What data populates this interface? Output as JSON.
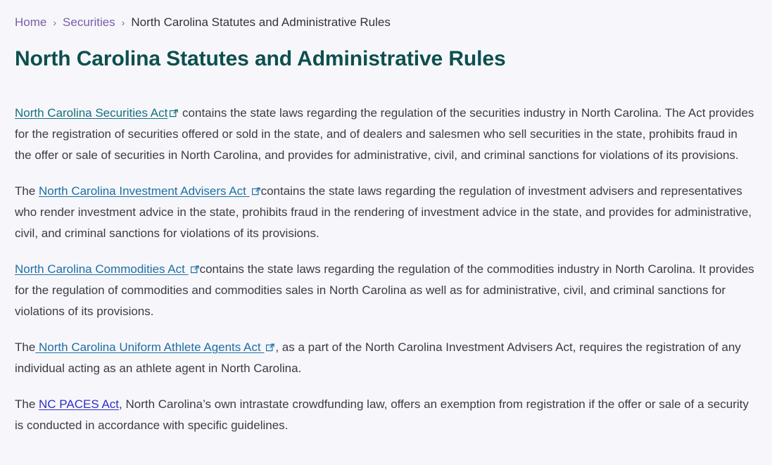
{
  "page": {
    "background_color": "#f7f7fb",
    "title": "North Carolina Statutes and Administrative Rules",
    "title_color": "#0d4f4f"
  },
  "breadcrumb": {
    "separator": "›",
    "link_color": "#7b5ea7",
    "items": [
      {
        "label": "Home",
        "type": "link"
      },
      {
        "label": "Securities",
        "type": "link"
      },
      {
        "label": "North Carolina Statutes and Administrative Rules",
        "type": "current"
      }
    ]
  },
  "icons": {
    "external_link": "external-link-icon",
    "chevron_right": "chevron-right-icon"
  },
  "content": {
    "paragraphs": [
      {
        "id": "securities-act",
        "lead_text": "",
        "link_text": "North Carolina Securities Act",
        "link_color": "#15707f",
        "has_external_icon": true,
        "body_text": " contains the state laws regarding the regulation of the securities industry in North Carolina. The Act provides for the registration of securities offered or sold in the state, and of dealers and salesmen who sell securities in the state, prohibits fraud in the offer or sale of securities in North Carolina, and provides for administrative, civil, and criminal sanctions for violations of its provisions."
      },
      {
        "id": "investment-advisers-act",
        "lead_text": "The ",
        "link_text": "North Carolina Investment Advisers Act ",
        "link_color": "#1d6fa5",
        "has_external_icon": true,
        "body_text": "contains the state laws regarding the regulation of investment advisers and representatives who render investment advice in the state, prohibits fraud in the rendering of investment advice in the state, and provides for administrative, civil, and criminal sanctions for violations of its provisions."
      },
      {
        "id": "commodities-act",
        "lead_text": "",
        "link_text": "North Carolina Commodities Act ",
        "link_color": "#1d6fa5",
        "has_external_icon": true,
        "body_text": "contains the state laws regarding the regulation of the commodities industry in North Carolina. It provides for the regulation of commodities and commodities sales in North Carolina as well as for administrative, civil, and criminal sanctions for violations of its provisions."
      },
      {
        "id": "uniform-athlete-agents-act",
        "lead_text": "The",
        "link_text": " North Carolina Uniform Athlete Agents Act ",
        "link_color": "#1d6fa5",
        "has_external_icon": true,
        "body_text": ", as a part of the North Carolina Investment Advisers Act, requires the registration of any individual acting as an athlete agent in North Carolina."
      },
      {
        "id": "nc-paces-act",
        "lead_text": "The ",
        "link_text": "NC PACES Act",
        "link_color": "#2e2ecb",
        "has_external_icon": false,
        "body_text": ", North Carolina’s own intrastate crowdfunding law, offers an exemption from registration if the offer or sale of a security is conducted in accordance with specific guidelines."
      }
    ]
  }
}
